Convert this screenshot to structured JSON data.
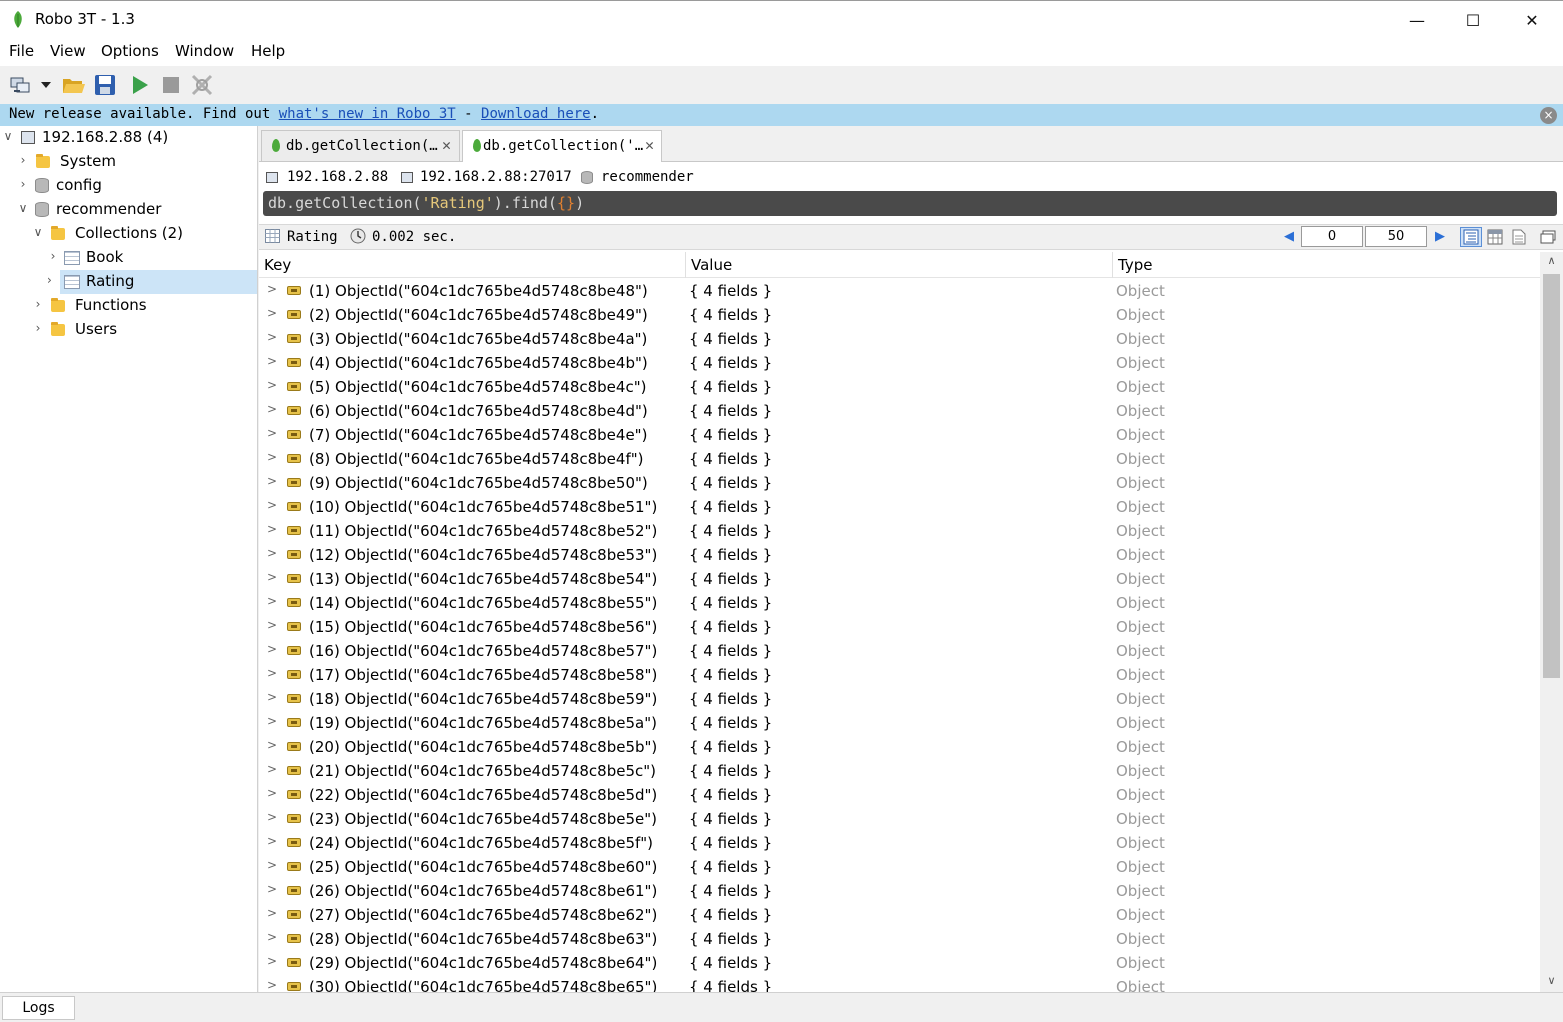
{
  "window": {
    "title": "Robo 3T - 1.3",
    "controls": {
      "minimize": "—",
      "maximize": "☐",
      "close": "✕"
    }
  },
  "menu": [
    "File",
    "View",
    "Options",
    "Window",
    "Help"
  ],
  "toolbar": {
    "icons": [
      "connect-icon",
      "dropdown-icon",
      "open-icon",
      "save-icon",
      "execute-icon",
      "stop-icon",
      "explain-icon"
    ]
  },
  "banner": {
    "prefix": "New release available. Find out ",
    "link1": "what's new in Robo 3T",
    "sep": " - ",
    "link2": "Download here",
    "suffix": ".",
    "close": "×"
  },
  "tree": {
    "server": "192.168.2.88 (4)",
    "items": [
      {
        "label": "System",
        "kind": "folder"
      },
      {
        "label": "config",
        "kind": "db"
      },
      {
        "label": "recommender",
        "kind": "db"
      },
      {
        "label": "Collections (2)",
        "kind": "folder"
      },
      {
        "label": "Book",
        "kind": "table"
      },
      {
        "label": "Rating",
        "kind": "table"
      },
      {
        "label": "Functions",
        "kind": "folder"
      },
      {
        "label": "Users",
        "kind": "folder"
      }
    ]
  },
  "tabs": [
    {
      "label": "db.getCollection(…",
      "close": "✕"
    },
    {
      "label": "db.getCollection('…",
      "close": "✕"
    }
  ],
  "conn": {
    "host": "192.168.2.88",
    "hostport": "192.168.2.88:27017",
    "database": "recommender"
  },
  "query": {
    "pre": "db.getCollection(",
    "arg": "'Rating'",
    "mid": ").find(",
    "braces": "{}",
    "post": ")"
  },
  "result": {
    "collection": "Rating",
    "time": "0.002 sec.",
    "skip": "0",
    "limit": "50",
    "prev": "◀",
    "next": "▶"
  },
  "columns": {
    "key": "Key",
    "value": "Value",
    "type": "Type"
  },
  "rows": [
    {
      "key": "(1) ObjectId(\"604c1dc765be4d5748c8be48\")",
      "value": "{ 4 fields }",
      "type": "Object"
    },
    {
      "key": "(2) ObjectId(\"604c1dc765be4d5748c8be49\")",
      "value": "{ 4 fields }",
      "type": "Object"
    },
    {
      "key": "(3) ObjectId(\"604c1dc765be4d5748c8be4a\")",
      "value": "{ 4 fields }",
      "type": "Object"
    },
    {
      "key": "(4) ObjectId(\"604c1dc765be4d5748c8be4b\")",
      "value": "{ 4 fields }",
      "type": "Object"
    },
    {
      "key": "(5) ObjectId(\"604c1dc765be4d5748c8be4c\")",
      "value": "{ 4 fields }",
      "type": "Object"
    },
    {
      "key": "(6) ObjectId(\"604c1dc765be4d5748c8be4d\")",
      "value": "{ 4 fields }",
      "type": "Object"
    },
    {
      "key": "(7) ObjectId(\"604c1dc765be4d5748c8be4e\")",
      "value": "{ 4 fields }",
      "type": "Object"
    },
    {
      "key": "(8) ObjectId(\"604c1dc765be4d5748c8be4f\")",
      "value": "{ 4 fields }",
      "type": "Object"
    },
    {
      "key": "(9) ObjectId(\"604c1dc765be4d5748c8be50\")",
      "value": "{ 4 fields }",
      "type": "Object"
    },
    {
      "key": "(10) ObjectId(\"604c1dc765be4d5748c8be51\")",
      "value": "{ 4 fields }",
      "type": "Object"
    },
    {
      "key": "(11) ObjectId(\"604c1dc765be4d5748c8be52\")",
      "value": "{ 4 fields }",
      "type": "Object"
    },
    {
      "key": "(12) ObjectId(\"604c1dc765be4d5748c8be53\")",
      "value": "{ 4 fields }",
      "type": "Object"
    },
    {
      "key": "(13) ObjectId(\"604c1dc765be4d5748c8be54\")",
      "value": "{ 4 fields }",
      "type": "Object"
    },
    {
      "key": "(14) ObjectId(\"604c1dc765be4d5748c8be55\")",
      "value": "{ 4 fields }",
      "type": "Object"
    },
    {
      "key": "(15) ObjectId(\"604c1dc765be4d5748c8be56\")",
      "value": "{ 4 fields }",
      "type": "Object"
    },
    {
      "key": "(16) ObjectId(\"604c1dc765be4d5748c8be57\")",
      "value": "{ 4 fields }",
      "type": "Object"
    },
    {
      "key": "(17) ObjectId(\"604c1dc765be4d5748c8be58\")",
      "value": "{ 4 fields }",
      "type": "Object"
    },
    {
      "key": "(18) ObjectId(\"604c1dc765be4d5748c8be59\")",
      "value": "{ 4 fields }",
      "type": "Object"
    },
    {
      "key": "(19) ObjectId(\"604c1dc765be4d5748c8be5a\")",
      "value": "{ 4 fields }",
      "type": "Object"
    },
    {
      "key": "(20) ObjectId(\"604c1dc765be4d5748c8be5b\")",
      "value": "{ 4 fields }",
      "type": "Object"
    },
    {
      "key": "(21) ObjectId(\"604c1dc765be4d5748c8be5c\")",
      "value": "{ 4 fields }",
      "type": "Object"
    },
    {
      "key": "(22) ObjectId(\"604c1dc765be4d5748c8be5d\")",
      "value": "{ 4 fields }",
      "type": "Object"
    },
    {
      "key": "(23) ObjectId(\"604c1dc765be4d5748c8be5e\")",
      "value": "{ 4 fields }",
      "type": "Object"
    },
    {
      "key": "(24) ObjectId(\"604c1dc765be4d5748c8be5f\")",
      "value": "{ 4 fields }",
      "type": "Object"
    },
    {
      "key": "(25) ObjectId(\"604c1dc765be4d5748c8be60\")",
      "value": "{ 4 fields }",
      "type": "Object"
    },
    {
      "key": "(26) ObjectId(\"604c1dc765be4d5748c8be61\")",
      "value": "{ 4 fields }",
      "type": "Object"
    },
    {
      "key": "(27) ObjectId(\"604c1dc765be4d5748c8be62\")",
      "value": "{ 4 fields }",
      "type": "Object"
    },
    {
      "key": "(28) ObjectId(\"604c1dc765be4d5748c8be63\")",
      "value": "{ 4 fields }",
      "type": "Object"
    },
    {
      "key": "(29) ObjectId(\"604c1dc765be4d5748c8be64\")",
      "value": "{ 4 fields }",
      "type": "Object"
    },
    {
      "key": "(30) ObjectId(\"604c1dc765be4d5748c8be65\")",
      "value": "{ 4 fields }",
      "type": "Object"
    }
  ],
  "bottom": {
    "logs": "Logs"
  },
  "colors": {
    "banner": "#add8f0",
    "selection": "#cce4f7",
    "query_bg": "#4a4a4a",
    "type_text": "#9a9a9a"
  }
}
